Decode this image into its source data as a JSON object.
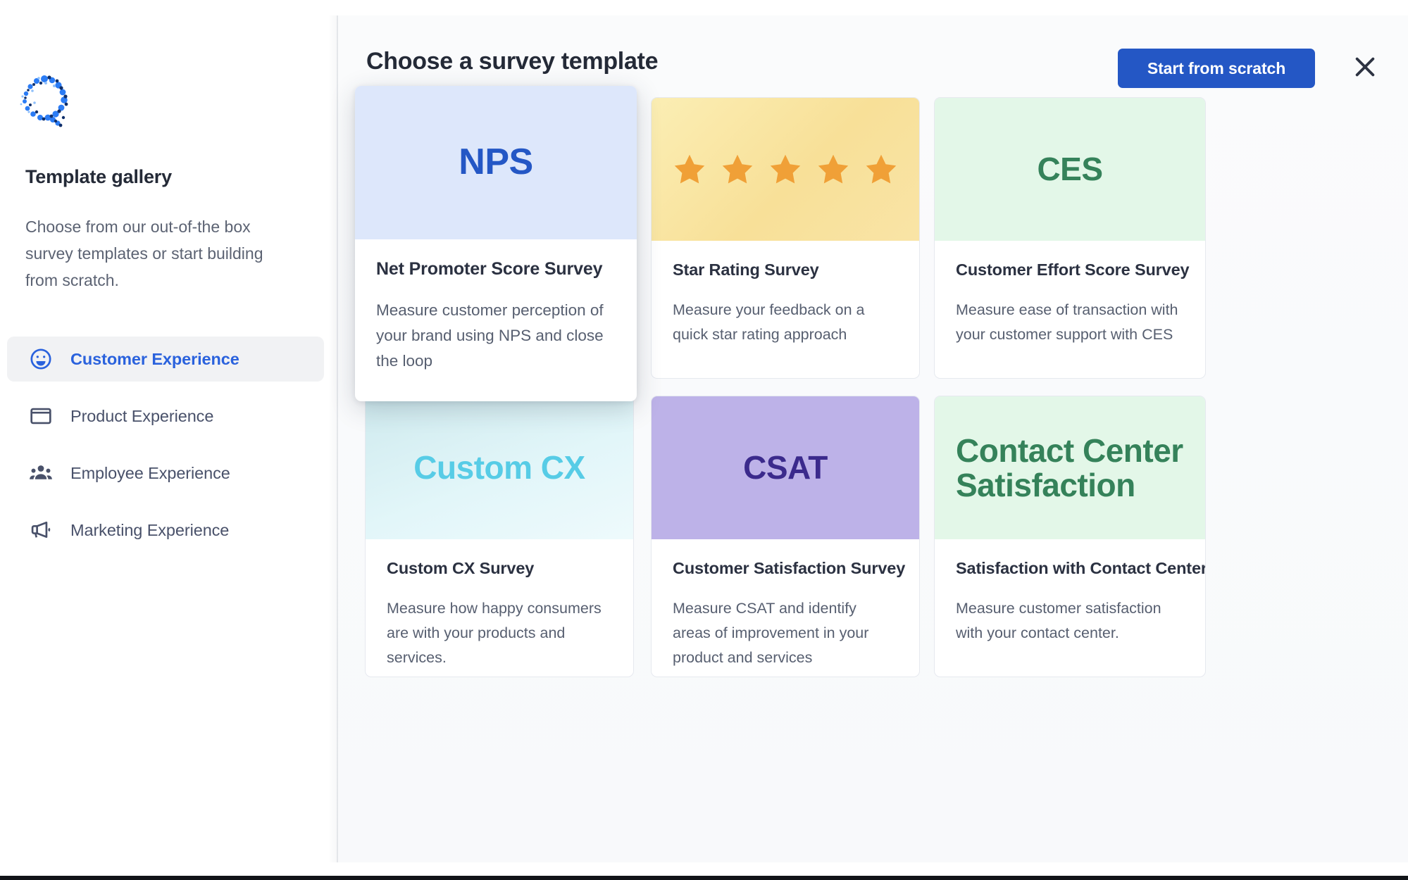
{
  "sidebar": {
    "logo_icon": "qualtrics-q-logo",
    "title": "Template gallery",
    "description": "Choose from our out-of-the box survey templates or start building from scratch.",
    "items": [
      {
        "label": "Customer Experience",
        "icon": "smiley-face-icon",
        "active": true
      },
      {
        "label": "Product Experience",
        "icon": "window-icon",
        "active": false
      },
      {
        "label": "Employee Experience",
        "icon": "people-group-icon",
        "active": false
      },
      {
        "label": "Marketing Experience",
        "icon": "megaphone-icon",
        "active": false
      }
    ]
  },
  "header": {
    "title": "Choose a survey template",
    "start_from_scratch_label": "Start from scratch",
    "close_icon": "close-x-icon",
    "accent_color": "#2457c5"
  },
  "cards": [
    {
      "id": "nps",
      "head_text": "NPS",
      "head_bg": "#dde7fb",
      "head_color": "#2457c5",
      "title": "Net Promoter Score Survey",
      "description": "Measure customer perception of your brand using NPS and close the loop",
      "featured": true
    },
    {
      "id": "star",
      "head_text": "",
      "head_icon": "five-stars-icon",
      "head_bg": "#f8e3a0",
      "head_color": "#f0a037",
      "star_count": 5,
      "title": "Star Rating Survey",
      "description": "Measure your feedback on a quick star rating approach",
      "featured": false
    },
    {
      "id": "ces",
      "head_text": "CES",
      "head_bg": "#e3f7e8",
      "head_color": "#35825a",
      "title": "Customer Effort Score Survey",
      "description": "Measure ease of transaction with your customer support with CES",
      "featured": false
    },
    {
      "id": "ccx",
      "head_text": "Custom CX",
      "head_bg": "#dff4f7",
      "head_color": "#57cce6",
      "title": "Custom CX Survey",
      "description": "Measure how happy consumers are with your products and services.",
      "featured": false
    },
    {
      "id": "csat",
      "head_text": "CSAT",
      "head_bg": "#bdb2e8",
      "head_color": "#3b2a8c",
      "title": "Customer Satisfaction Survey",
      "description": "Measure CSAT and identify areas of improvement in your product and services",
      "featured": false
    },
    {
      "id": "cc",
      "head_text": "Contact Center Satisfaction",
      "head_bg": "#e3f7e8",
      "head_color": "#35825a",
      "title": "Satisfaction with Contact Center",
      "description": "Measure customer satisfaction with your contact center.",
      "featured": false
    }
  ]
}
